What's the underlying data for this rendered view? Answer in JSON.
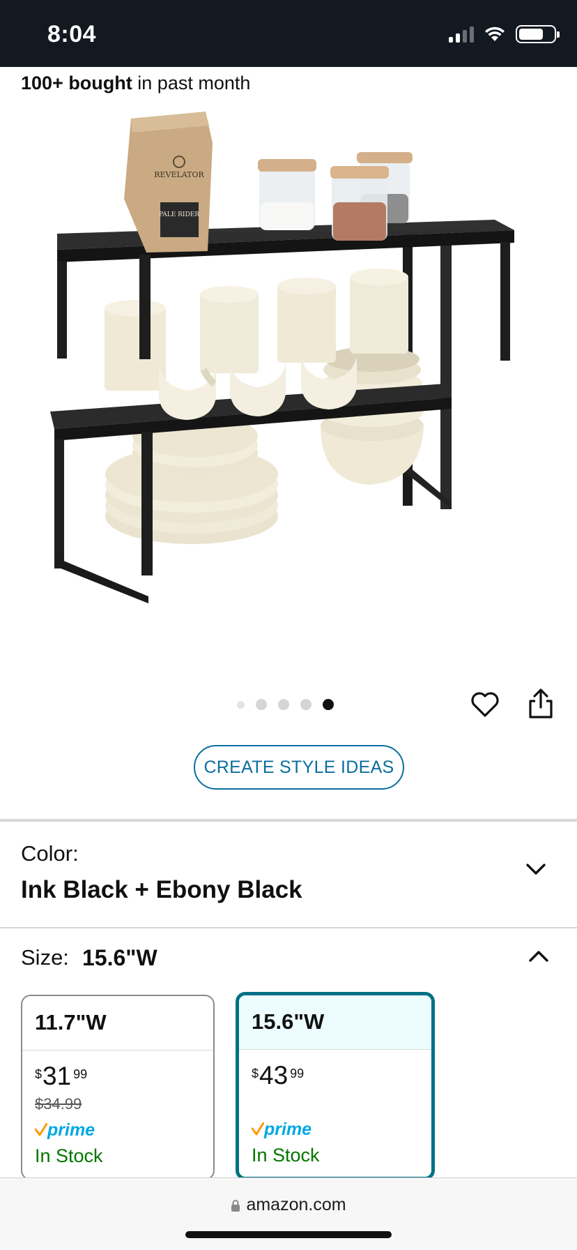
{
  "status_bar": {
    "time": "8:04"
  },
  "bought": {
    "bold": "100+ bought",
    "rest": " in past month"
  },
  "carousel": {
    "count": 5,
    "active_index": 4
  },
  "style_button": {
    "label": "CREATE STYLE IDEAS"
  },
  "color": {
    "label": "Color:",
    "value": "Ink Black + Ebony Black"
  },
  "size": {
    "label": "Size:",
    "value": "15.6\"W",
    "options": [
      {
        "name": "11.7\"W",
        "price_symbol": "$",
        "price_whole": "31",
        "price_fraction": "99",
        "list_price": "$34.99",
        "prime": "prime",
        "stock": "In Stock",
        "selected": false
      },
      {
        "name": "15.6\"W",
        "price_symbol": "$",
        "price_whole": "43",
        "price_fraction": "99",
        "list_price": "",
        "prime": "prime",
        "stock": "In Stock",
        "selected": true
      }
    ]
  },
  "url_bar": {
    "domain": "amazon.com"
  },
  "colors": {
    "header_bg": "#131921",
    "link_blue": "#0a6e9e",
    "selected_teal": "#007185",
    "stock_green": "#007600",
    "prime_blue": "#00a8e1",
    "prime_check": "#ff9900"
  },
  "icons": [
    "signal-icon",
    "wifi-icon",
    "battery-icon",
    "heart-icon",
    "share-icon",
    "chevron-down-icon",
    "chevron-up-icon",
    "lock-icon",
    "prime-check-icon"
  ]
}
